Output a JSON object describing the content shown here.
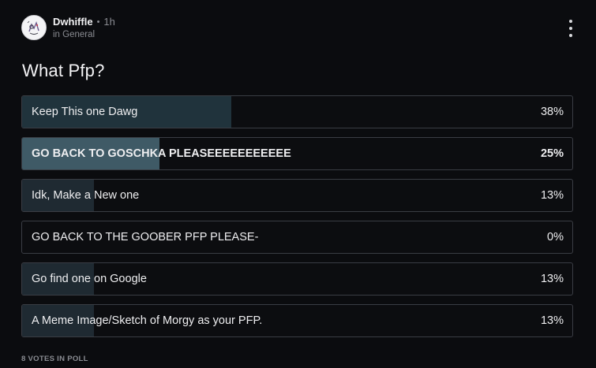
{
  "post": {
    "author": "Dwhiffle",
    "separator": "•",
    "time": "1h",
    "channel": "in General",
    "avatar_icon": "sketch-avatar-icon",
    "menu_icon": "kebab-menu-icon"
  },
  "poll": {
    "question": "What Pfp?",
    "options": [
      {
        "label": "Keep This one Dawg",
        "percent_text": "38%",
        "percent": 38,
        "state": "leading"
      },
      {
        "label": "GO BACK TO GOSCHKA PLEASEEEEEEEEEEE",
        "percent_text": "25%",
        "percent": 25,
        "state": "selected"
      },
      {
        "label": "Idk, Make a New one",
        "percent_text": "13%",
        "percent": 13,
        "state": "normal"
      },
      {
        "label": "GO BACK TO THE GOOBER PFP PLEASE-",
        "percent_text": "0%",
        "percent": 0,
        "state": "normal"
      },
      {
        "label": "Go find one on Google",
        "percent_text": "13%",
        "percent": 13,
        "state": "normal"
      },
      {
        "label": "A Meme Image/Sketch of Morgy as your PFP.",
        "percent_text": "13%",
        "percent": 13,
        "state": "normal"
      }
    ],
    "votes_text": "8 VOTES IN POLL"
  },
  "colors": {
    "background": "#0b0c0f",
    "border": "#3a3d44",
    "fill_default": "#1f2a32",
    "fill_leading": "#20333c",
    "fill_selected": "#3f5a66",
    "muted_text": "#8a8c92"
  }
}
